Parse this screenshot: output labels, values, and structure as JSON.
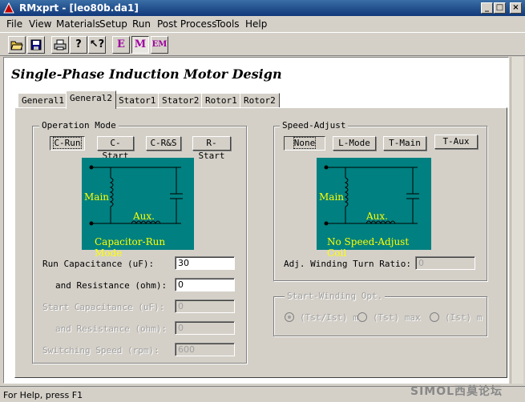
{
  "window": {
    "title": "RMxprt - [leo80b.da1]",
    "min": "_",
    "max": "□",
    "close": "×"
  },
  "menu": [
    "File",
    "View",
    "Materials",
    "Setup",
    "Run",
    "Post Process",
    "Tools",
    "Help"
  ],
  "toolbar": {
    "e_label": "E",
    "m_label": "M",
    "em_label": "EM"
  },
  "page_title": "Single-Phase Induction Motor Design",
  "tabs": [
    "General1",
    "General2",
    "Stator1",
    "Stator2",
    "Rotor1",
    "Rotor2"
  ],
  "active_tab": "General2",
  "operation_mode": {
    "label": "Operation Mode",
    "buttons": [
      "C-Run",
      "C-Start",
      "C-R&S",
      "R-Start"
    ],
    "selected": "C-Run",
    "diagram": {
      "main": "Main",
      "aux": "Aux.",
      "caption": "Capacitor-Run Mode"
    },
    "fields": [
      {
        "label": "Run Capacitance (uF):",
        "value": "30",
        "enabled": true
      },
      {
        "label": "and Resistance (ohm):",
        "value": "0",
        "enabled": true
      },
      {
        "label": "Start Capacitance (uF):",
        "value": "0",
        "enabled": false
      },
      {
        "label": "and Resistance (ohm):",
        "value": "0",
        "enabled": false
      },
      {
        "label": "Switching Speed (rpm):",
        "value": "600",
        "enabled": false
      }
    ]
  },
  "speed_adjust": {
    "label": "Speed-Adjust",
    "buttons": [
      "None",
      "L-Mode",
      "T-Main",
      "T-Aux"
    ],
    "selected": "None",
    "diagram": {
      "main": "Main",
      "aux": "Aux.",
      "caption": "No Speed-Adjust Coil"
    },
    "ratio_label": "Adj. Winding Turn Ratio:",
    "ratio_value": "0"
  },
  "start_winding": {
    "label": "Start-Winding Opt.",
    "options": [
      "(Tst/Ist) m",
      "(Tst) max",
      "(Ist) min"
    ],
    "selected": 0
  },
  "status": "For Help, press F1",
  "watermark": "SIMOL西莫论坛"
}
